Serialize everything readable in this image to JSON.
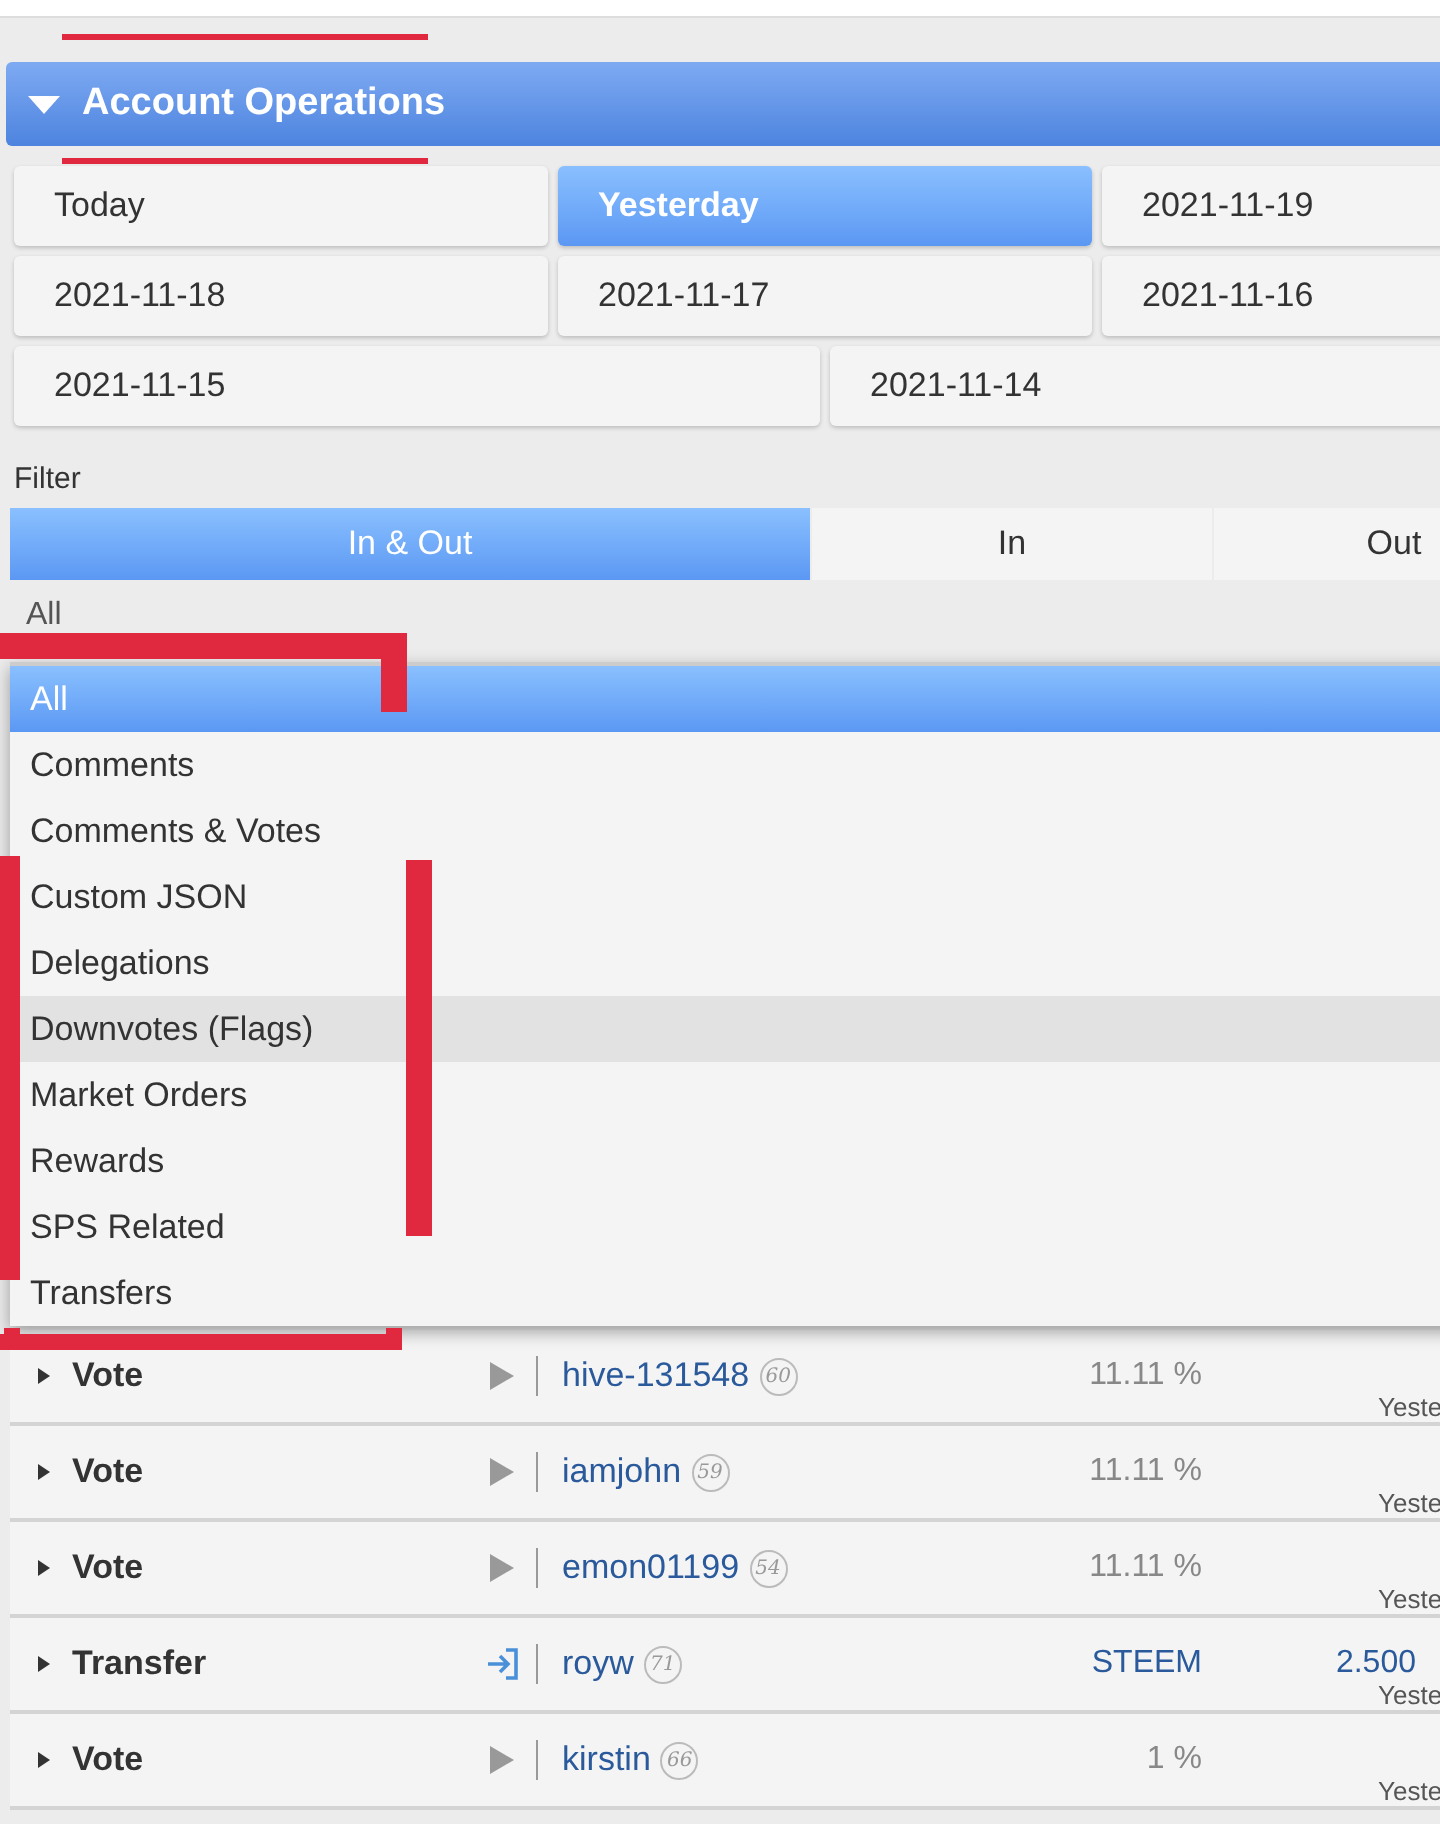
{
  "section": {
    "title": "Account Operations",
    "expanded": true
  },
  "date_buttons": [
    {
      "label": "Today",
      "selected": false
    },
    {
      "label": "Yesterday",
      "selected": true
    },
    {
      "label": "2021-11-19",
      "selected": false
    },
    {
      "label": "2021-11-18",
      "selected": false
    },
    {
      "label": "2021-11-17",
      "selected": false
    },
    {
      "label": "2021-11-16",
      "selected": false
    },
    {
      "label": "2021-11-15",
      "selected": false
    },
    {
      "label": "2021-11-14",
      "selected": false
    }
  ],
  "filter": {
    "label": "Filter",
    "tabs": [
      {
        "label": "In & Out",
        "selected": true
      },
      {
        "label": "In",
        "selected": false
      },
      {
        "label": "Out",
        "selected": false
      }
    ],
    "select_value": "All",
    "options": [
      {
        "label": "All",
        "selected": true,
        "hovered": false
      },
      {
        "label": "Comments",
        "selected": false,
        "hovered": false
      },
      {
        "label": "Comments & Votes",
        "selected": false,
        "hovered": false
      },
      {
        "label": "Custom JSON",
        "selected": false,
        "hovered": false
      },
      {
        "label": "Delegations",
        "selected": false,
        "hovered": false
      },
      {
        "label": "Downvotes (Flags)",
        "selected": false,
        "hovered": true
      },
      {
        "label": "Market Orders",
        "selected": false,
        "hovered": false
      },
      {
        "label": "Rewards",
        "selected": false,
        "hovered": false
      },
      {
        "label": "SPS Related",
        "selected": false,
        "hovered": false
      },
      {
        "label": "Transfers",
        "selected": false,
        "hovered": false
      }
    ]
  },
  "operations": [
    {
      "kind": "vote",
      "type": "Vote",
      "user": "hive-131548",
      "reputation": "60",
      "amount": "11.11 %",
      "date": "Yeste"
    },
    {
      "kind": "vote",
      "type": "Vote",
      "user": "iamjohn",
      "reputation": "59",
      "amount": "11.11 %",
      "date": "Yeste"
    },
    {
      "kind": "vote",
      "type": "Vote",
      "user": "emon01199",
      "reputation": "54",
      "amount": "11.11 %",
      "date": "Yeste"
    },
    {
      "kind": "transfer",
      "type": "Transfer",
      "user": "royw",
      "reputation": "71",
      "amount": "STEEM",
      "value": "2.500",
      "date": "Yeste"
    },
    {
      "kind": "vote",
      "type": "Vote",
      "user": "kirstin",
      "reputation": "66",
      "amount": "1 %",
      "date": "Yeste"
    }
  ]
}
